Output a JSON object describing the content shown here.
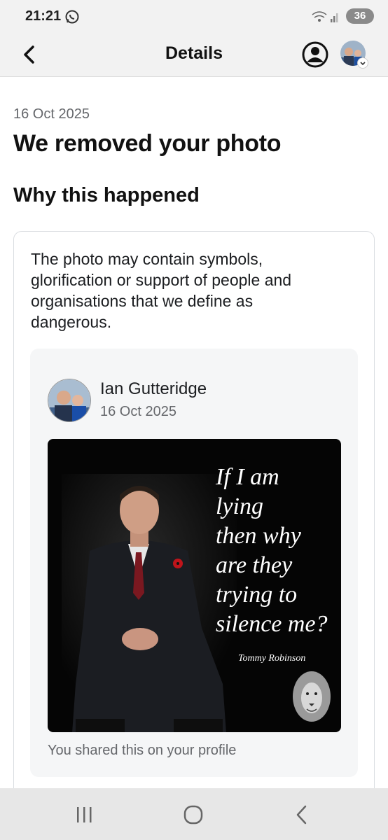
{
  "status_bar": {
    "time": "21:21",
    "battery": "36",
    "icons": [
      "whatsapp-icon",
      "wifi-icon",
      "signal-icon"
    ]
  },
  "header": {
    "title": "Details",
    "icons": [
      "back-arrow-icon",
      "profile-circle-icon",
      "account-avatar"
    ]
  },
  "content": {
    "date": "16 Oct 2025",
    "title": "We removed your photo",
    "section_title": "Why this happened",
    "reason": "The photo may contain symbols, glorification or support of people and organisations that we define as dangerous."
  },
  "post": {
    "author": "Ian Gutteridge",
    "date": "16 Oct 2025",
    "image": {
      "quote_lines": [
        "If I am",
        "lying",
        "then why",
        "are they",
        "trying to",
        "silence me?"
      ],
      "attribution": "Tommy Robinson"
    },
    "shared_note": "You shared this on your profile"
  },
  "nav_bar": {
    "buttons": [
      "recents-icon",
      "home-icon",
      "back-icon"
    ]
  },
  "colors": {
    "background": "#ffffff",
    "header_bg": "#f2f2f2",
    "secondary_text": "#65676b",
    "post_bg": "#f5f6f7",
    "image_bg": "#050505"
  }
}
